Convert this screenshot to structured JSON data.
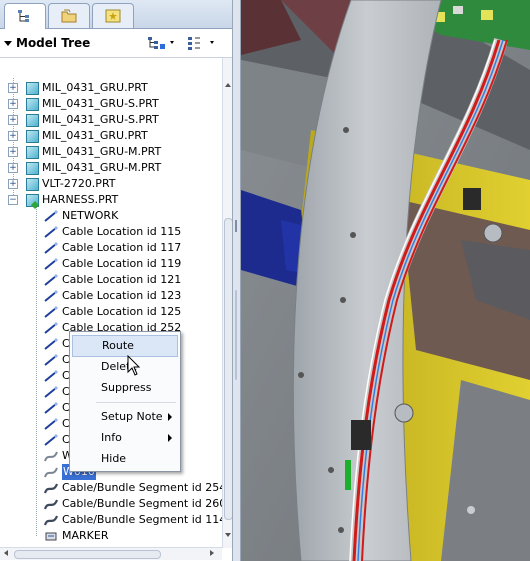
{
  "panel": {
    "title": "Model Tree",
    "tabs": [
      "model-tree-tab",
      "folder-browser-tab",
      "favorites-tab"
    ]
  },
  "tree": {
    "parts": [
      "MIL_0431_GRU.PRT",
      "MIL_0431_GRU-S.PRT",
      "MIL_0431_GRU-S.PRT",
      "MIL_0431_GRU.PRT",
      "MIL_0431_GRU-M.PRT",
      "MIL_0431_GRU-M.PRT",
      "VLT-2720.PRT",
      "HARNESS.PRT"
    ],
    "harness_children": [
      "NETWORK",
      "Cable Location id 115",
      "Cable Location id 117",
      "Cable Location id 119",
      "Cable Location id 121",
      "Cable Location id 123",
      "Cable Location id 125",
      "Cable Location id 252",
      "Ca",
      "Ca",
      "Ca",
      "Ca",
      "Ca",
      "Ca",
      "Ca",
      "W01",
      "W010",
      "Cable/Bundle Segment id 254",
      "Cable/Bundle Segment id 260",
      "Cable/Bundle Segment id 114",
      "MARKER"
    ]
  },
  "context_menu": {
    "items": [
      "Route",
      "Delete",
      "Suppress",
      "Setup Note",
      "Info",
      "Hide"
    ]
  },
  "colors": {
    "selection": "#3a6fd3",
    "menu_highlight": "#dbe6f6"
  }
}
